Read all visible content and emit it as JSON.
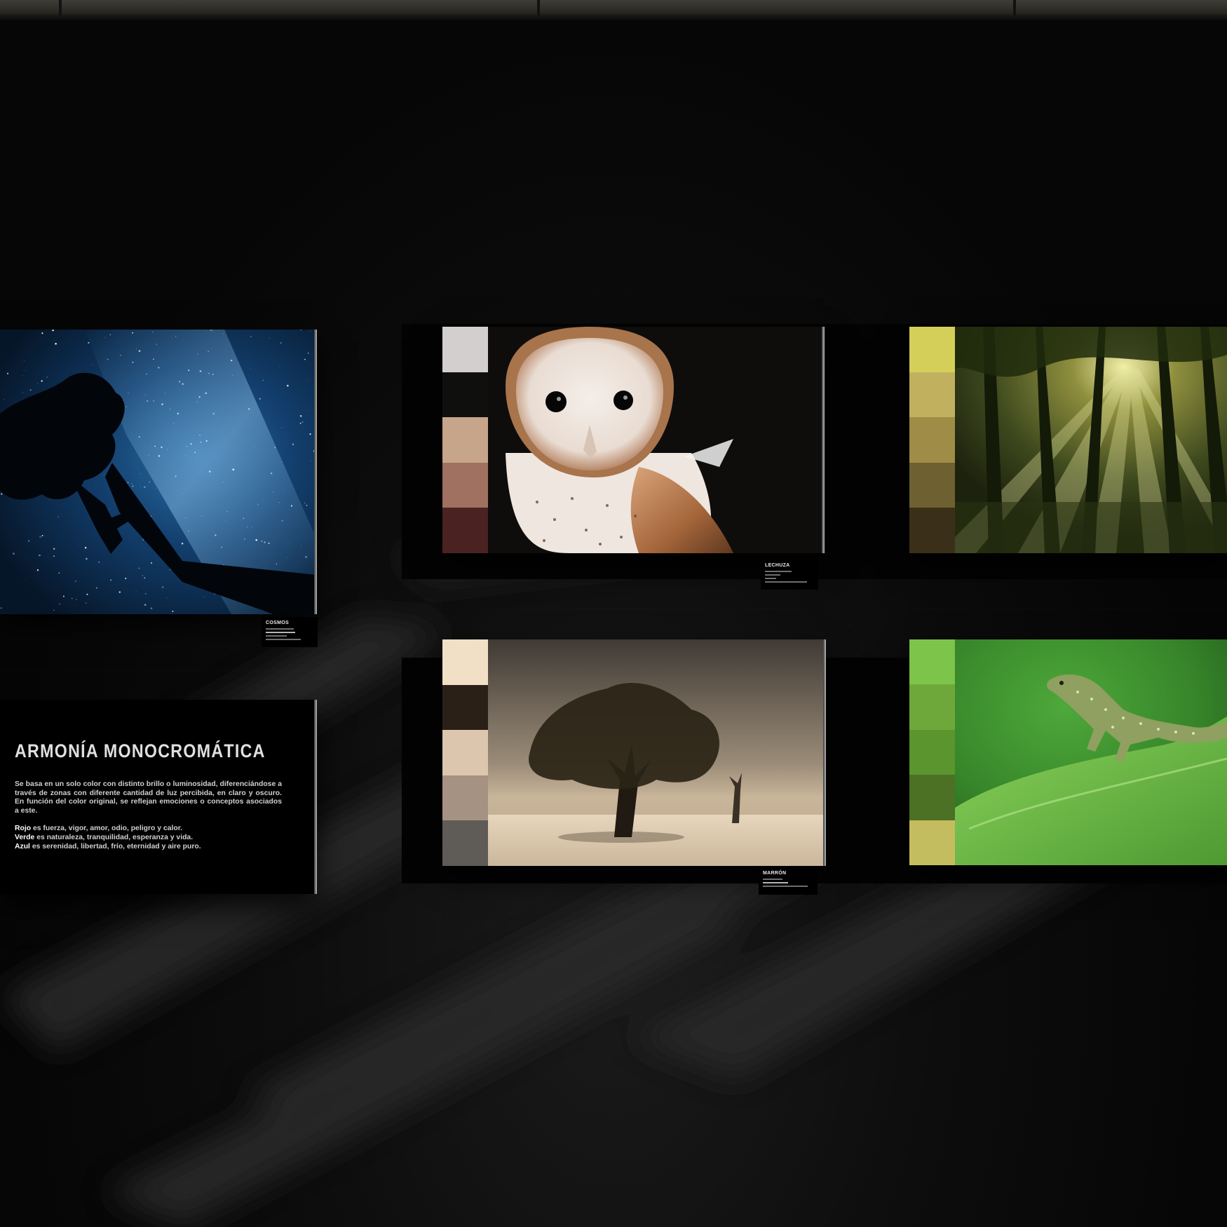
{
  "exhibit": {
    "title": "ARMONÍA MONOCROMÁTICA",
    "description": "Se basa en un solo color con distinto brillo o luminosidad, diferenciándose a través de zonas con diferente cantidad de luz percibida, en claro y oscuro. En función del color original, se reflejan emociones o conceptos asociados a este.",
    "meanings": [
      {
        "color": "Rojo",
        "text": " es fuerza, vigor, amor, odio, peligro y calor."
      },
      {
        "color": "Verde",
        "text": " es naturaleza, tranquilidad, esperanza y vida."
      },
      {
        "color": "Azul",
        "text": " es serenidad, libertad, frío, eternidad y aire puro."
      }
    ]
  },
  "artworks": {
    "night_sky": {
      "label": "COSMOS",
      "subject": "starry-sky-tree-silhouette",
      "colors": [
        "#06142a",
        "#0b2c55",
        "#1d5a93",
        "#03070d"
      ]
    },
    "owl": {
      "label": "LECHUZA",
      "subject": "barn-owl",
      "swatches": [
        "#d4cfcf",
        "#0f0f0d",
        "#c7a58a",
        "#a07060",
        "#4a2222"
      ]
    },
    "forest": {
      "subject": "forest-sun-rays",
      "swatches": [
        "#d4cf59",
        "#c1b15f",
        "#9f8d47",
        "#6e6031",
        "#3a3019"
      ]
    },
    "tree": {
      "label": "MARRÓN",
      "subject": "lone-tree-field",
      "swatches": [
        "#f1e0c6",
        "#2a2018",
        "#dcc6ae",
        "#a69283",
        "#5f5b56"
      ]
    },
    "lizard": {
      "subject": "green-lizard",
      "swatches": [
        "#7cc44a",
        "#6ea83a",
        "#5a952d",
        "#4c7024",
        "#c4bd5f"
      ]
    }
  }
}
